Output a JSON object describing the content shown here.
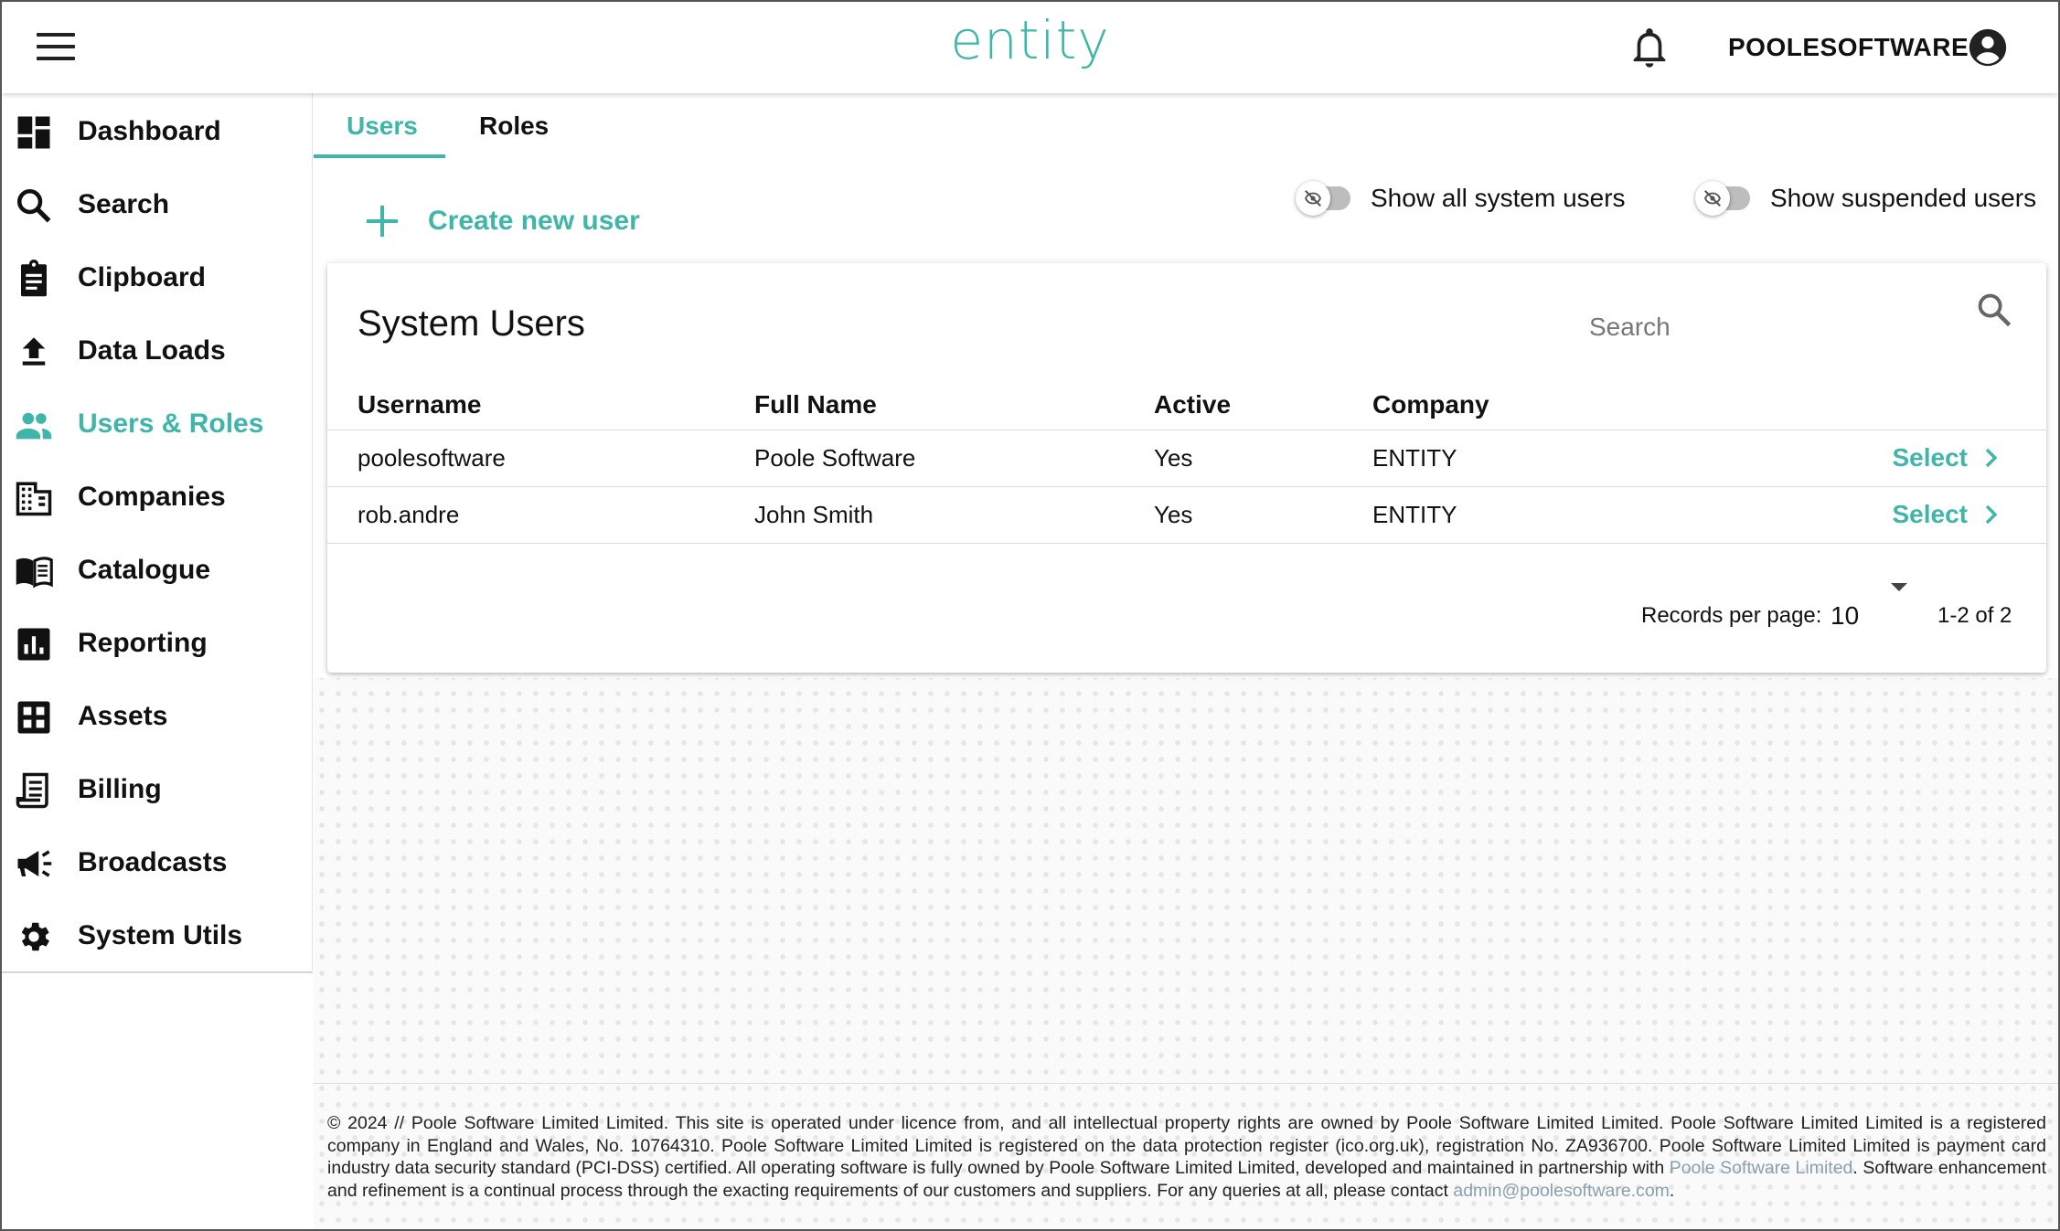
{
  "header": {
    "logo": "entity",
    "username": "POOLESOFTWARE",
    "accent_color": "#3fb6a8"
  },
  "sidebar": {
    "items": [
      {
        "label": "Dashboard",
        "icon": "dashboard-icon"
      },
      {
        "label": "Search",
        "icon": "search-icon"
      },
      {
        "label": "Clipboard",
        "icon": "clipboard-icon"
      },
      {
        "label": "Data Loads",
        "icon": "upload-icon"
      },
      {
        "label": "Users & Roles",
        "icon": "people-icon",
        "active": true
      },
      {
        "label": "Companies",
        "icon": "building-icon"
      },
      {
        "label": "Catalogue",
        "icon": "book-icon"
      },
      {
        "label": "Reporting",
        "icon": "bar-chart-icon"
      },
      {
        "label": "Assets",
        "icon": "grid-icon"
      },
      {
        "label": "Billing",
        "icon": "receipt-icon"
      },
      {
        "label": "Broadcasts",
        "icon": "megaphone-icon"
      },
      {
        "label": "System Utils",
        "icon": "gear-icon"
      }
    ]
  },
  "tabs": [
    {
      "label": "Users",
      "active": true
    },
    {
      "label": "Roles",
      "active": false
    }
  ],
  "actions": {
    "create_label": "Create new user",
    "toggle_system_label": "Show all system users",
    "toggle_suspended_label": "Show suspended users"
  },
  "card": {
    "title": "System Users",
    "search_placeholder": "Search",
    "columns": [
      "Username",
      "Full Name",
      "Active",
      "Company"
    ],
    "rows": [
      {
        "username": "poolesoftware",
        "full_name": "Poole Software",
        "active": "Yes",
        "company": "ENTITY",
        "action": "Select"
      },
      {
        "username": "rob.andre",
        "full_name": "John Smith",
        "active": "Yes",
        "company": "ENTITY",
        "action": "Select"
      }
    ],
    "pagination": {
      "records_label": "Records per page:",
      "records_value": "10",
      "range": "1-2 of 2"
    }
  },
  "footer": {
    "text_1": "© 2024 // Poole Software Limited Limited. This site is operated under licence from, and all intellectual property rights are owned by Poole Software Limited Limited. Poole Software Limited Limited is a registered company in England and Wales, No. 10764310. Poole Software Limited Limited is registered on the data protection register (ico.org.uk), registration No. ZA936700. Poole Software Limited Limited is payment card industry data security standard (PCI-DSS) certified. All operating software is fully owned by Poole Software Limited Limited, developed and maintained in partnership with ",
    "link_company": "Poole Software Limited",
    "text_2": ". Software enhancement and refinement is a continual process through the exacting requirements of our customers and suppliers. For any queries at all, please contact ",
    "link_email": "admin@poolesoftware.com",
    "text_3": "."
  }
}
